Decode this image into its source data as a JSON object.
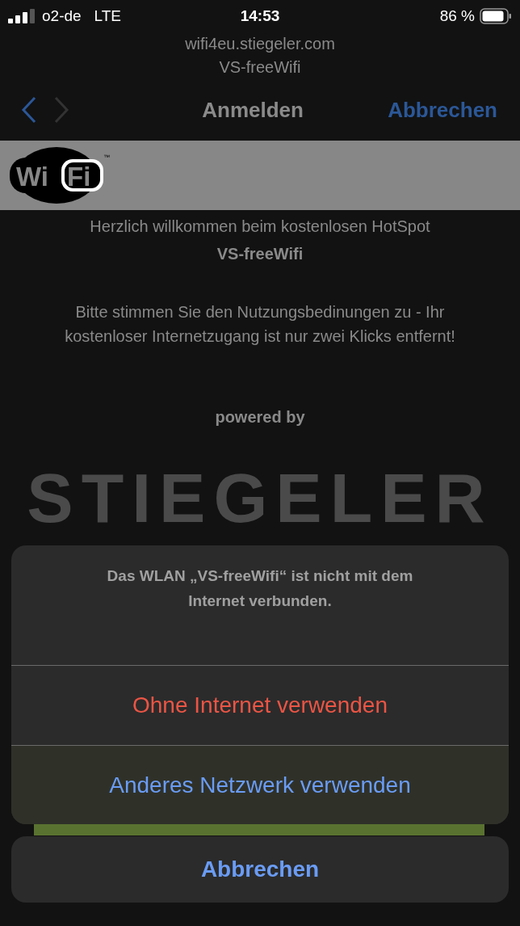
{
  "status_bar": {
    "carrier": "o2-de",
    "network": "LTE",
    "time": "14:53",
    "battery": "86 %"
  },
  "header": {
    "url": "wifi4eu.stiegeler.com",
    "network_name": "VS-freeWifi"
  },
  "nav": {
    "back_disabled": false,
    "forward_disabled": true,
    "title": "Anmelden",
    "cancel": "Abbrechen"
  },
  "wifi_logo": {
    "left": "Wi",
    "right": "Fi",
    "mark": "™"
  },
  "content": {
    "welcome": "Herzlich willkommen beim kostenlosen HotSpot",
    "hotspot": "VS-freeWifi",
    "instructions": "Bitte stimmen Sie den Nutzungsbedinungen zu - Ihr kostenloser Internetzugang ist nur zwei Klicks entfernt!",
    "powered_by": "powered by",
    "brand": "STIEGELER"
  },
  "action_sheet": {
    "message": "Das WLAN „VS-freeWifi“ ist nicht mit dem Internet verbunden.",
    "actions": [
      {
        "label": "Ohne Internet verwenden",
        "kind": "destructive"
      },
      {
        "label": "Anderes Netzwerk verwenden",
        "kind": "default"
      }
    ],
    "cancel": "Abbrechen"
  }
}
